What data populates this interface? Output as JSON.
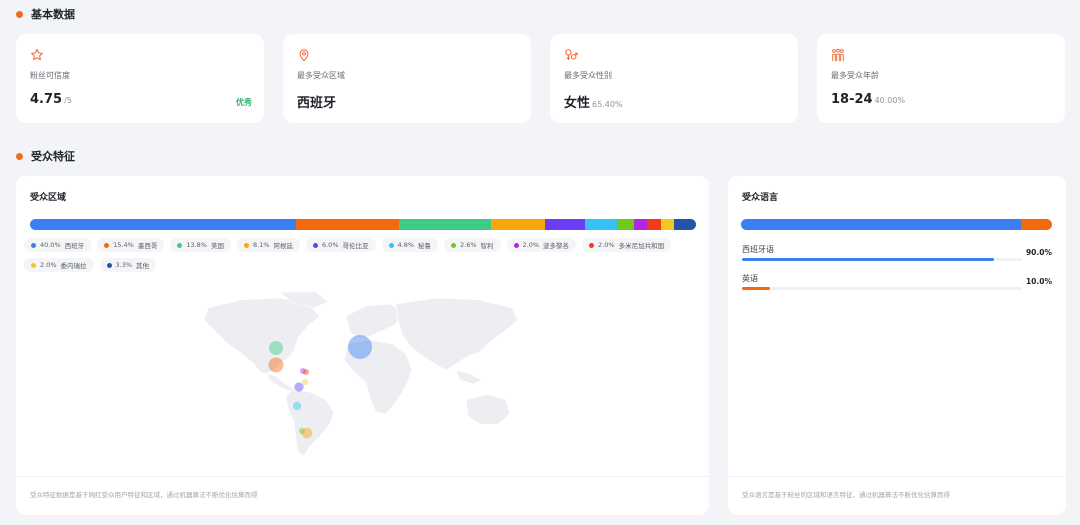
{
  "basic_section": {
    "title": "基本数据"
  },
  "stats": [
    {
      "icon": "star-icon",
      "label": "粉丝可信度",
      "value": "4.75",
      "sub": "/5",
      "badge": "优秀"
    },
    {
      "icon": "location-pin-icon",
      "label": "最多受众区域",
      "value": "西班牙",
      "sub": ""
    },
    {
      "icon": "gender-icon",
      "label": "最多受众性别",
      "value": "女性",
      "sub": "65.40%"
    },
    {
      "icon": "people-icon",
      "label": "最多受众年龄",
      "value": "18-24",
      "sub": "40.00%"
    }
  ],
  "audience_section": {
    "title": "受众特征"
  },
  "region": {
    "title": "受众区域",
    "items": [
      {
        "pct": "40.0%",
        "name": "西班牙",
        "value": 40.0,
        "color": "#3b7ff1"
      },
      {
        "pct": "15.4%",
        "name": "墨西哥",
        "value": 15.4,
        "color": "#f26a0f"
      },
      {
        "pct": "13.8%",
        "name": "美国",
        "value": 13.8,
        "color": "#3ecb86"
      },
      {
        "pct": "8.1%",
        "name": "阿根廷",
        "value": 8.1,
        "color": "#f7a70b"
      },
      {
        "pct": "6.0%",
        "name": "哥伦比亚",
        "value": 6.0,
        "color": "#6a3df5"
      },
      {
        "pct": "4.8%",
        "name": "秘鲁",
        "value": 4.8,
        "color": "#36c2f5"
      },
      {
        "pct": "2.6%",
        "name": "智利",
        "value": 2.6,
        "color": "#6fcb1a"
      },
      {
        "pct": "2.0%",
        "name": "波多黎各",
        "value": 2.0,
        "color": "#b027e0"
      },
      {
        "pct": "2.0%",
        "name": "多米尼加共和国",
        "value": 2.0,
        "color": "#f23b1b"
      },
      {
        "pct": "2.0%",
        "name": "委内瑞拉",
        "value": 2.0,
        "color": "#f6c81c"
      },
      {
        "pct": "3.3%",
        "name": "其他",
        "value": 3.3,
        "color": "#2354a8"
      }
    ],
    "footnote": "受众特征数据是基于网红受众用户特征和区域，通过机器算法不断优化估算而得"
  },
  "language": {
    "title": "受众语言",
    "items": [
      {
        "name": "西班牙语",
        "pct": "90.0%",
        "value": 90.0,
        "color": "#3b7ff1"
      },
      {
        "name": "英语",
        "pct": "10.0%",
        "value": 10.0,
        "color": "#f26a0f"
      }
    ],
    "footnote": "受众语言是基于粉丝的区域和语言特征，通过机器算法不断优化估算而得"
  }
}
